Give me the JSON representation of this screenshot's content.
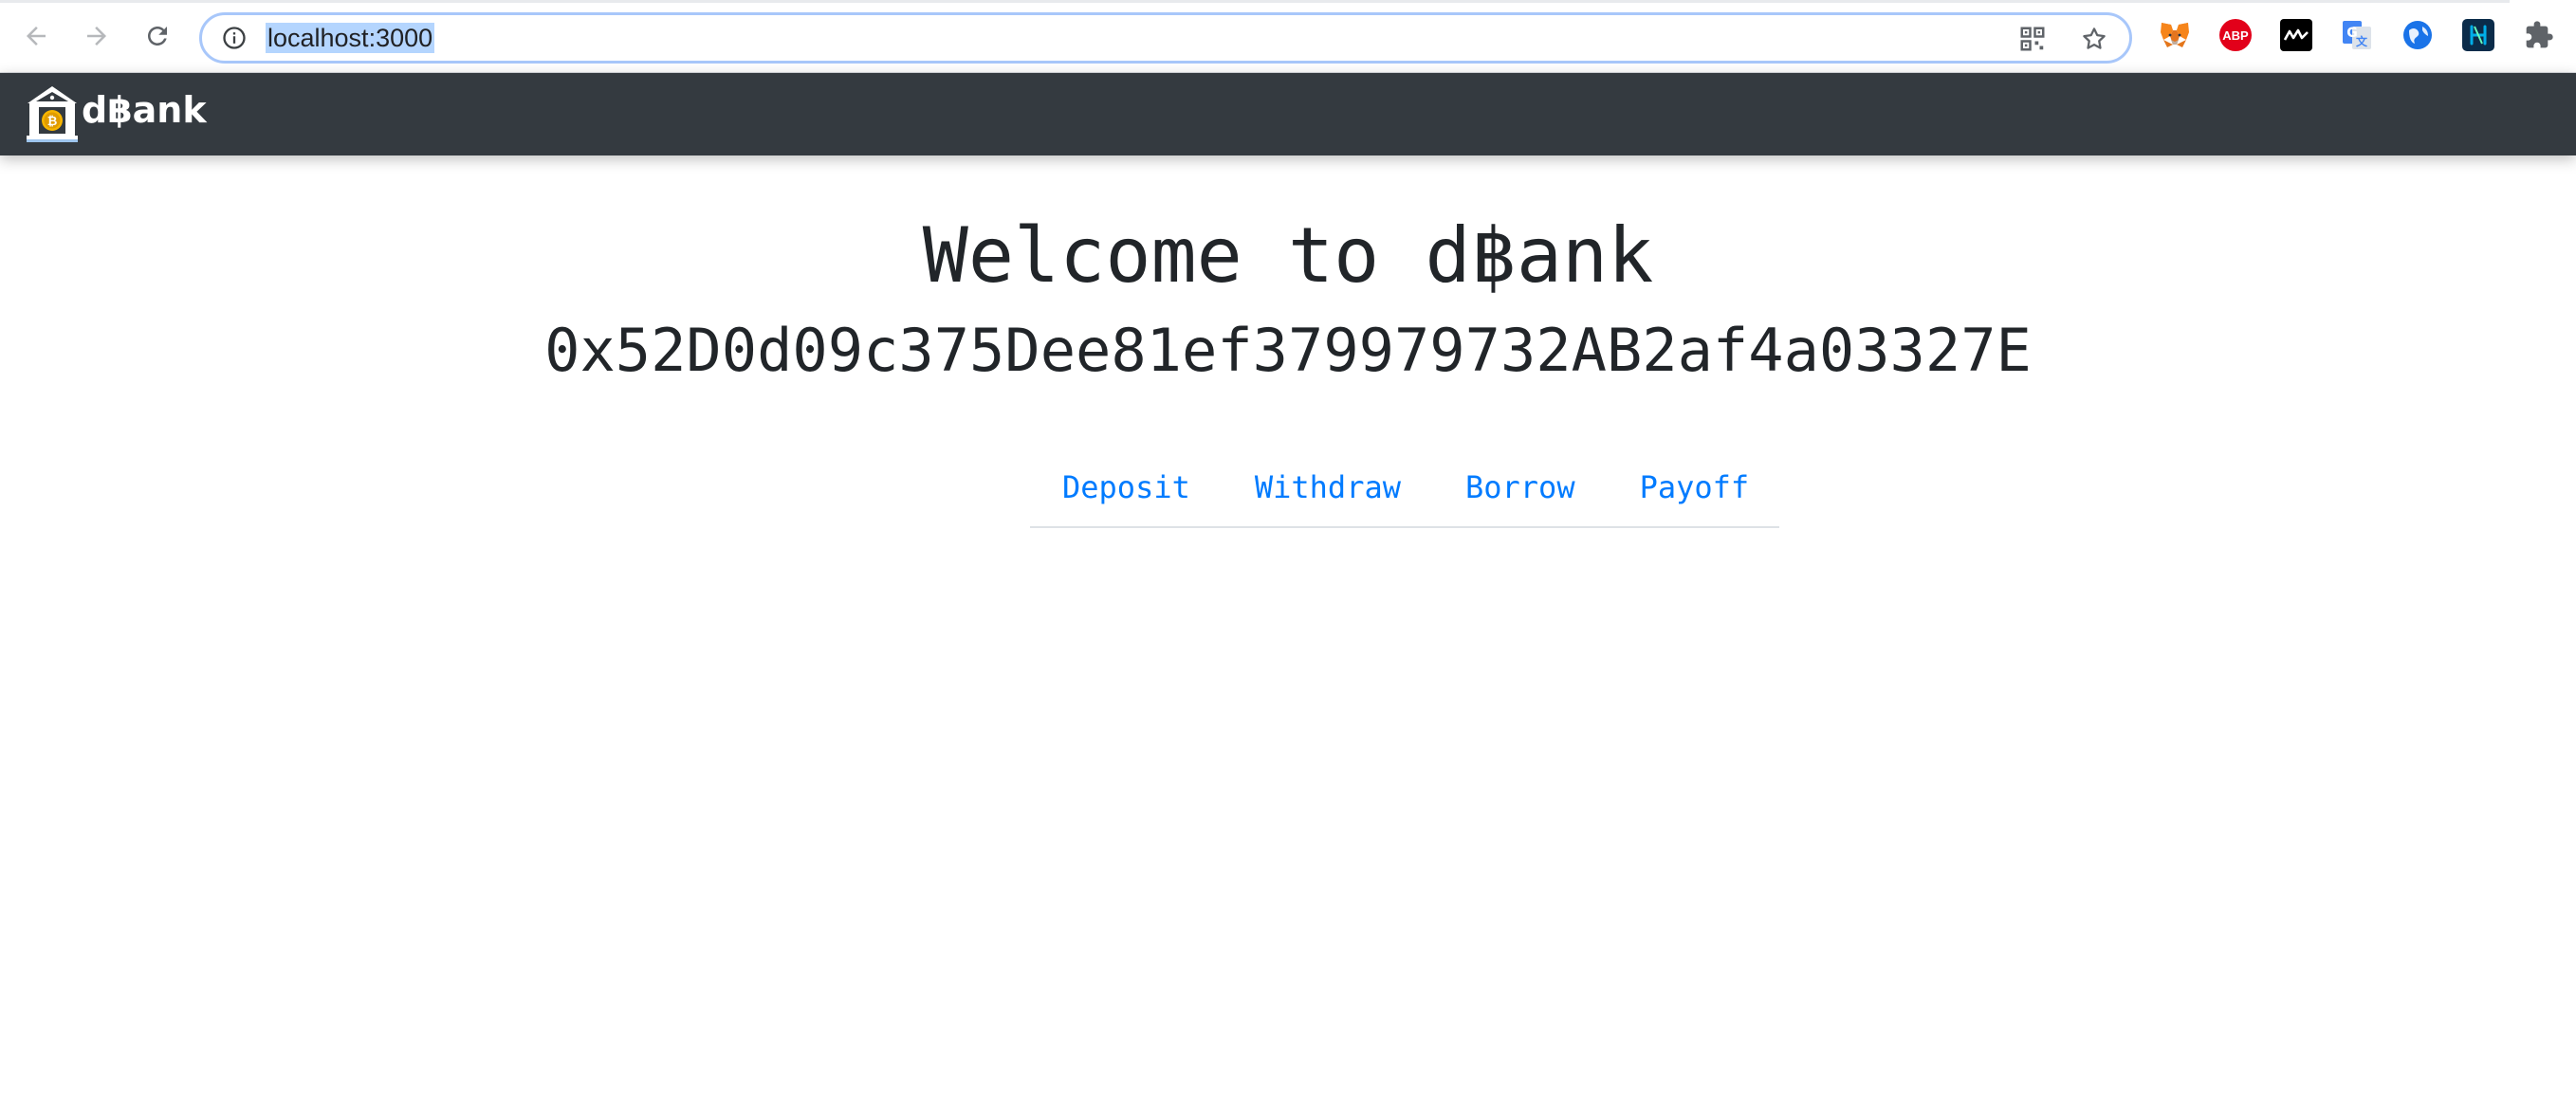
{
  "browser": {
    "url": "localhost:3000",
    "back_icon": "arrow-left-icon",
    "forward_icon": "arrow-right-icon",
    "reload_icon": "reload-icon",
    "extensions": [
      "metamask-fox-icon",
      "adblock-plus-icon",
      "waves-extension-icon",
      "google-translate-icon",
      "globe-extension-icon",
      "harmony-extension-icon",
      "puzzle-extensions-icon"
    ],
    "adblock_label": "ABP"
  },
  "navbar": {
    "brand_text": "d฿ank",
    "logo_icon": "bank-bitcoin-logo-icon",
    "background": "#343a40"
  },
  "main": {
    "title": "Welcome to d฿ank",
    "account": "0x52D0d09c375Dee81ef379979732AB2af4a03327E",
    "tabs": [
      {
        "label": "Deposit"
      },
      {
        "label": "Withdraw"
      },
      {
        "label": "Borrow"
      },
      {
        "label": "Payoff"
      }
    ],
    "link_color": "#007bff"
  }
}
